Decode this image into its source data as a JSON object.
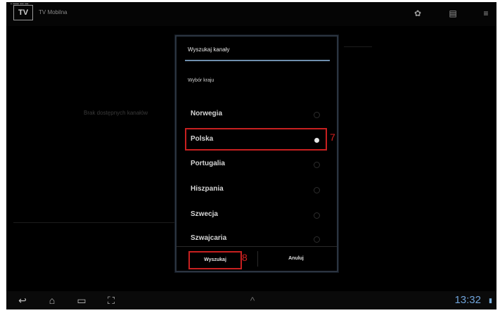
{
  "status": {
    "tiny_left": "▪ ▪▪▪▪▪   ▪▪▪ ▪▪▪"
  },
  "app": {
    "logo": "TV",
    "title": "TV Mobilna"
  },
  "background": {
    "empty_message": "Brak dostępnych kanałów"
  },
  "dialog": {
    "title": "Wyszukaj kanały",
    "section_label": "Wybór kraju",
    "countries": [
      {
        "label": "Norwegia",
        "selected": false
      },
      {
        "label": "Polska",
        "selected": true
      },
      {
        "label": "Portugalia",
        "selected": false
      },
      {
        "label": "Hiszpania",
        "selected": false
      },
      {
        "label": "Szwecja",
        "selected": false
      },
      {
        "label": "Szwajcaria",
        "selected": false
      }
    ],
    "search_button": "Wyszukaj",
    "cancel_button": "Anuluj"
  },
  "annotations": {
    "marker_7": "7",
    "marker_8": "8"
  },
  "system": {
    "clock": "13:32"
  },
  "colors": {
    "highlight": "#c82020",
    "accent_line": "#6f8fae",
    "clock": "#6fa2d8"
  }
}
